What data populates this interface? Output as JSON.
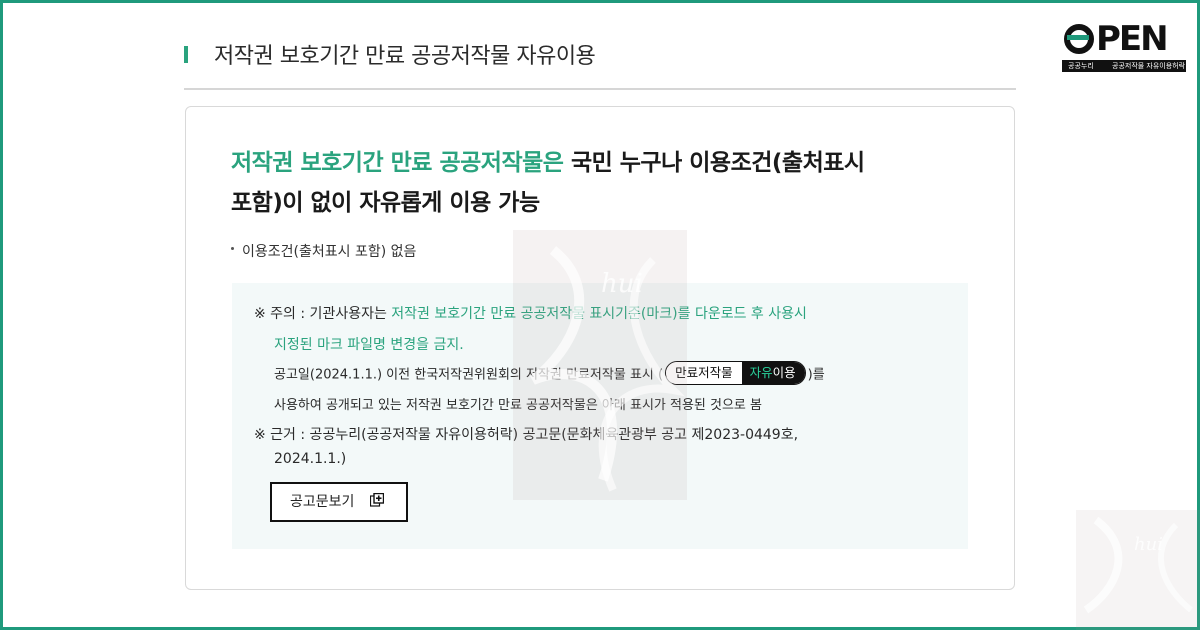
{
  "section": {
    "title": "저작권 보호기간 만료 공공저작물 자유이용"
  },
  "logo": {
    "word": "OPEN",
    "strip_left": "공공누리",
    "strip_right": "공공저작물 자유이용허락"
  },
  "lead": {
    "highlight": "저작권 보호기간 만료 공공저작물은",
    "rest_line1": " 국민 누구나 이용조건(출처표시",
    "line2": "포함)이 없이 자유롭게 이용 가능"
  },
  "bullet": "이용조건(출처표시 포함) 없음",
  "notice": {
    "caution_prefix": "※ 주의 : 기관사용자는 ",
    "caution_green1": "저작권 보호기간 만료 공공저작물 표시기준(마크)를 다운로드 후 사용시",
    "caution_green2": "지정된 마크 파일명 변경을 금지.",
    "announce_before": "공고일(2024.1.1.) 이전 한국저작권위원회의 저작권 만료저작물 표시 (",
    "announce_after": ")를",
    "announce_line2": "사용하여 공개되고 있는 저작권 보호기간 만료 공공저작물은 아래 표시가 적용된 것으로 봄",
    "basis_line1": "※ 근거 : 공공누리(공공저작물 자유이용허락) 공고문(문화체육관광부 공고 제2023-0449호,",
    "basis_line2": "2024.1.1.)",
    "pill_left": "만료저작물",
    "pill_right_green": "자유",
    "pill_right_white": "이용",
    "button_label": "공고문보기"
  },
  "colors": {
    "accent": "#2aa37e",
    "frame": "#1f9a7c"
  }
}
